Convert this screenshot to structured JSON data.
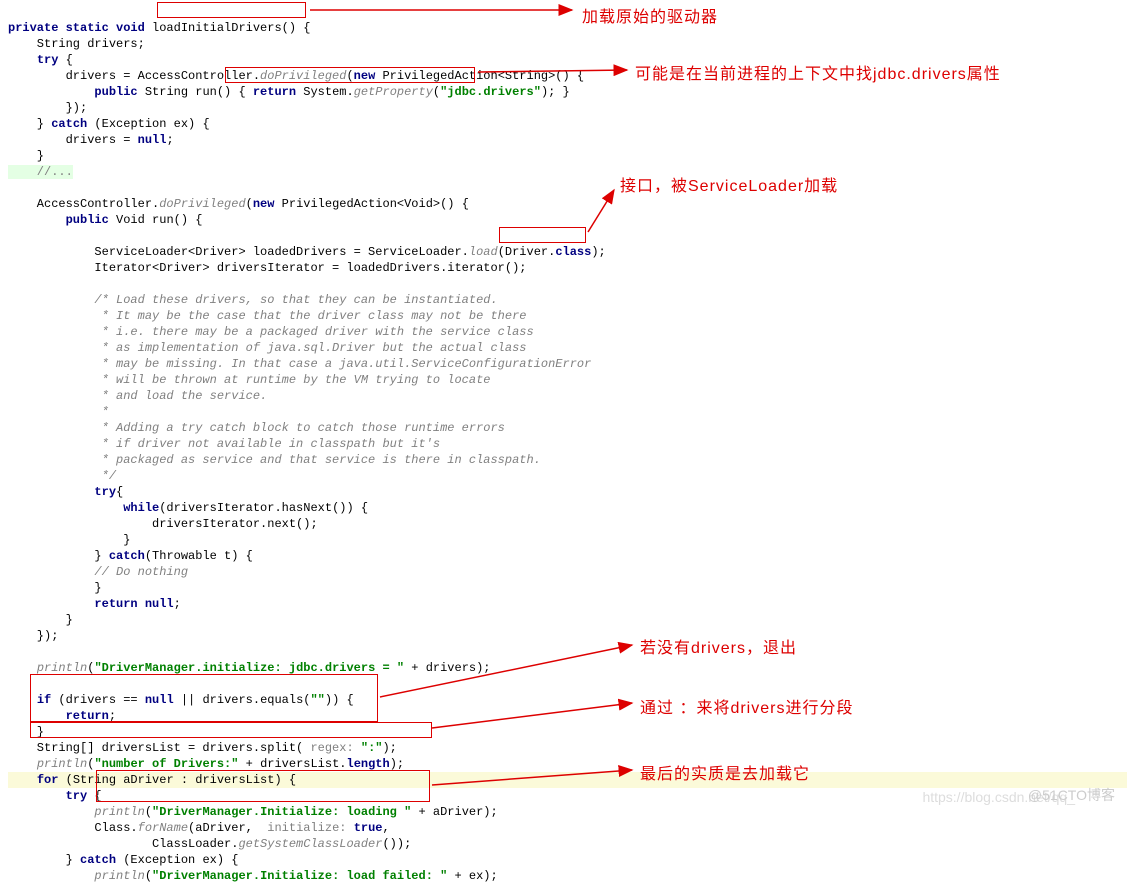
{
  "code": {
    "l01a": "private static void",
    "l01b": "loadInitialDrivers()",
    "l01c": " {",
    "l02": "    String drivers;",
    "l03a": "    ",
    "l03b": "try",
    "l03c": " {",
    "l04a": "        drivers = AccessController.",
    "l04b": "doPrivileged",
    "l04c": "(",
    "l04d": "new",
    "l04e": " PrivilegedAction<String>() {",
    "l05a": "            ",
    "l05b": "public",
    "l05c": " String run() { ",
    "l05d": "return",
    "l05e": " System.",
    "l05f": "getProperty",
    "l05g": "(",
    "l05h": "\"jdbc.drivers\"",
    "l05i": "); }",
    "l06": "        });",
    "l07a": "    } ",
    "l07b": "catch",
    "l07c": " (Exception ex) {",
    "l08a": "        drivers = ",
    "l08b": "null",
    "l08c": ";",
    "l09": "    }",
    "l10": "    //...",
    "l11": "",
    "l12a": "    AccessController.",
    "l12b": "doPrivileged",
    "l12c": "(",
    "l12d": "new",
    "l12e": " PrivilegedAction<Void>() {",
    "l13a": "        ",
    "l13b": "public",
    "l13c": " Void run() {",
    "l14": "",
    "l15a": "            ServiceLoader<Driver> loadedDrivers = ServiceLoader.",
    "l15b": "load",
    "l15c": "(",
    "l15d": "Driver.",
    "l15e": "class",
    "l15f": ");",
    "l16": "            Iterator<Driver> driversIterator = loadedDrivers.iterator();",
    "l17": "",
    "c1": "            /* Load these drivers, so that they can be instantiated.",
    "c2": "             * It may be the case that the driver class may not be there",
    "c3": "             * i.e. there may be a packaged driver with the service class",
    "c4": "             * as implementation of java.sql.Driver but the actual class",
    "c5": "             * may be missing. In that case a java.util.ServiceConfigurationError",
    "c6": "             * will be thrown at runtime by the VM trying to locate",
    "c7": "             * and load the service.",
    "c8": "             *",
    "c9": "             * Adding a try catch block to catch those runtime errors",
    "c10": "             * if driver not available in classpath but it's",
    "c11": "             * packaged as service and that service is there in classpath.",
    "c12": "             */",
    "l30a": "            ",
    "l30b": "try",
    "l30c": "{",
    "l31a": "                ",
    "l31b": "while",
    "l31c": "(driversIterator.hasNext()) {",
    "l32": "                    driversIterator.next();",
    "l33": "                }",
    "l34a": "            } ",
    "l34b": "catch",
    "l34c": "(Throwable t) {",
    "l35": "            // Do nothing",
    "l36": "            }",
    "l37a": "            ",
    "l37b": "return null",
    "l37c": ";",
    "l38": "        }",
    "l39": "    });",
    "l40": "",
    "l41a": "    ",
    "l41b": "println",
    "l41c": "(",
    "l41d": "\"DriverManager.initialize: jdbc.drivers = \"",
    "l41e": " + drivers);",
    "l42": "",
    "l43a": "    ",
    "l43b": "if",
    "l43c": " (drivers == ",
    "l43d": "null",
    "l43e": " || drivers.equals(",
    "l43f": "\"\"",
    "l43g": ")) {",
    "l44a": "        ",
    "l44b": "return",
    "l44c": ";",
    "l45": "    }",
    "l46a": "    String[] driversList = drivers.split( ",
    "l46hint": "regex: ",
    "l46b": "\":\"",
    "l46c": ");",
    "l47a": "    ",
    "l47b": "println",
    "l47c": "(",
    "l47d": "\"number of Drivers:\"",
    "l47e": " + driversList.",
    "l47f": "length",
    "l47g": ");",
    "l48a": "    ",
    "l48b": "for",
    "l48c": " (String aDriver : driversList) {",
    "l49a": "        ",
    "l49b": "try",
    "l49c": " {",
    "l50a": "            ",
    "l50b": "println",
    "l50c": "(",
    "l50d": "\"DriverManager.Initialize: loading \"",
    "l50e": " + aDriver);",
    "l51a": "            Class.",
    "l51b": "forName",
    "l51c": "(aDriver,  ",
    "l51hint": "initialize: ",
    "l51d": "true",
    "l51e": ",",
    "l52a": "                    ClassLoader.",
    "l52b": "getSystemClassLoader",
    "l52c": "());",
    "l53a": "        } ",
    "l53b": "catch",
    "l53c": " (Exception ex) {",
    "l54a": "            ",
    "l54b": "println",
    "l54c": "(",
    "l54d": "\"DriverManager.Initialize: load failed: \"",
    "l54e": " + ex);"
  },
  "annotations": {
    "a1": "加载原始的驱动器",
    "a2": "可能是在当前进程的上下文中找jdbc.drivers属性",
    "a3": "接口，被ServiceLoader加载",
    "a4": "若没有drivers，退出",
    "a5": "通过 ：来将drivers进行分段",
    "a6": "最后的实质是去加载它"
  },
  "watermarks": {
    "w1": "@51CTO博客",
    "w2": "https://blog.csdn.net/qq_"
  }
}
